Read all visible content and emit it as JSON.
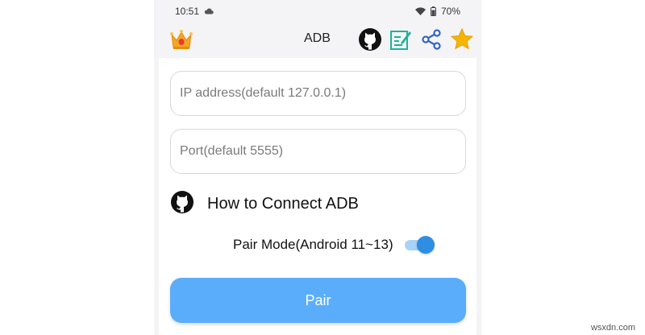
{
  "status_bar": {
    "time": "10:51",
    "battery": "70%",
    "icons": [
      "cloud-icon",
      "wifi-icon",
      "battery-icon"
    ]
  },
  "app_bar": {
    "title": "ADB",
    "actions": [
      "github-icon",
      "edit-note-icon",
      "share-icon",
      "star-icon"
    ]
  },
  "form": {
    "ip_placeholder": "IP address(default 127.0.0.1)",
    "ip_value": "",
    "port_placeholder": "Port(default 5555)",
    "port_value": ""
  },
  "help_link": {
    "label": "How to Connect ADB"
  },
  "pair_mode": {
    "label": "Pair Mode(Android 11~13)",
    "enabled": true
  },
  "pair_button": {
    "label": "Pair"
  },
  "watermark": "wsxdn.com",
  "colors": {
    "accent": "#5aadfb",
    "toggle_knob": "#2f8de4",
    "toggle_track": "#a8d3f7",
    "edit_icon": "#1bb39b",
    "share_icon": "#2e64c8",
    "star_icon": "#f7b500"
  }
}
